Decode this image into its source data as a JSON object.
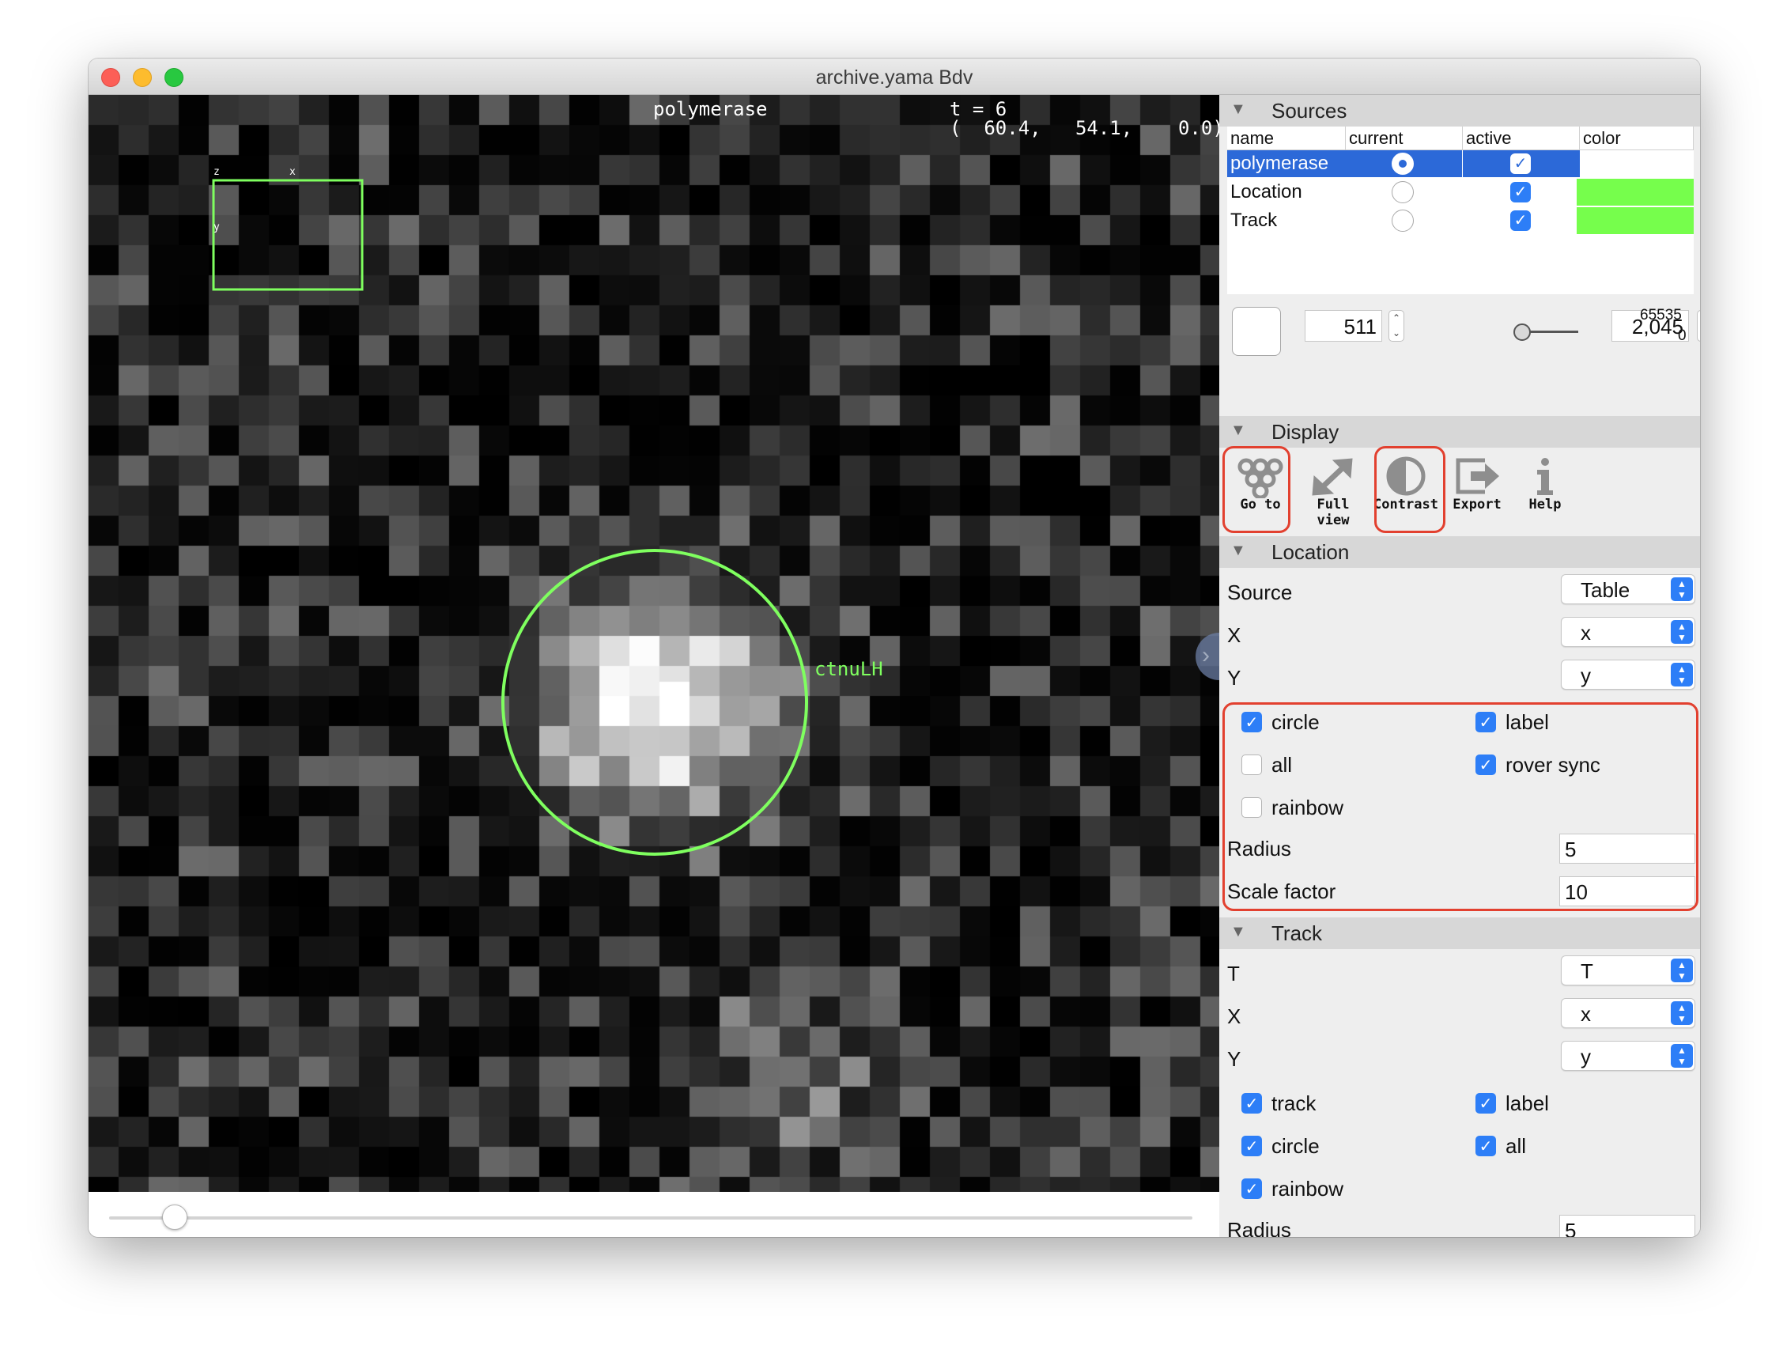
{
  "window": {
    "title": "archive.yama Bdv"
  },
  "viewer": {
    "source_label": "polymerase",
    "time_label": "t = 6",
    "coord_label": "(  60.4,   54.1,    0.0)",
    "spot_label": "ctnuLH",
    "axis_z": "z",
    "axis_x": "x",
    "axis_y": "y",
    "overlay_color": "#7fff5f"
  },
  "time_slider": {
    "value_fraction": 0.03
  },
  "sources": {
    "header": "Sources",
    "columns": [
      "name",
      "current",
      "active",
      "color"
    ],
    "rows": [
      {
        "name": "polymerase",
        "current": true,
        "active": true,
        "color": ""
      },
      {
        "name": "Location",
        "current": false,
        "active": true,
        "color": "#76fe4c"
      },
      {
        "name": "Track",
        "current": false,
        "active": true,
        "color": "#76fe4c"
      }
    ]
  },
  "range": {
    "min": "511",
    "max": "2,045",
    "limit_max": "65535",
    "limit_min": "0"
  },
  "display": {
    "header": "Display",
    "tools": [
      {
        "label": "Go to",
        "icon": "goto-icon"
      },
      {
        "label": "Full view",
        "icon": "full-view-icon"
      },
      {
        "label": "Contrast",
        "icon": "contrast-icon"
      },
      {
        "label": "Export",
        "icon": "export-icon"
      },
      {
        "label": "Help",
        "icon": "help-icon"
      }
    ]
  },
  "location": {
    "header": "Location",
    "source_label": "Source",
    "source_value": "Table",
    "x_label": "X",
    "x_value": "x",
    "y_label": "Y",
    "y_value": "y",
    "circle": "circle",
    "label": "label",
    "all": "all",
    "rover_sync": "rover sync",
    "rainbow": "rainbow",
    "radius_label": "Radius",
    "radius_value": "5",
    "scale_label": "Scale factor",
    "scale_value": "10"
  },
  "track": {
    "header": "Track",
    "t_label": "T",
    "t_value": "T",
    "x_label": "X",
    "x_value": "x",
    "y_label": "Y",
    "y_value": "y",
    "track": "track",
    "label": "label",
    "circle": "circle",
    "all": "all",
    "rainbow": "rainbow",
    "radius_label": "Radius",
    "radius_value": "5"
  }
}
